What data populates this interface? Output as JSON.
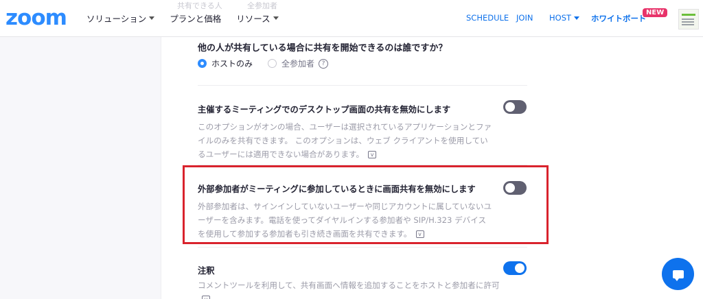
{
  "header": {
    "logo": "zoom",
    "nav_left": [
      {
        "label": "ソリューション",
        "caret": true
      },
      {
        "label": "プランと価格",
        "caret": false
      },
      {
        "label": "リソース",
        "caret": true
      }
    ],
    "schedule": "SCHEDULE",
    "join": "JOIN",
    "host": "HOST",
    "whiteboard": "ホワイトボード",
    "new_badge": "NEW",
    "ghost_left": "共有できる人",
    "ghost_right": "全参加者"
  },
  "sharing_question": {
    "title": "他の人が共有している場合に共有を開始できるのは誰ですか？",
    "options": [
      "ホストのみ",
      "全参加者"
    ],
    "selected": "ホストのみ",
    "help_icon": "?"
  },
  "settings": [
    {
      "title": "主催するミーティングでのデスクトップ画面の共有を無効にします",
      "desc": "このオプションがオンの場合、ユーザーは選択されているアプリケーションとファイルのみを共有できます。 このオプションは、ウェブ クライアントを使用しているユーザーには適用できない場合があります。",
      "toggle": "off"
    },
    {
      "title": "外部参加者がミーティングに参加しているときに画面共有を無効にします",
      "desc": "外部参加者は、サインインしていないユーザーや同じアカウントに属していないユーザーを含みます。電話を使ってダイヤルインする参加者や SIP/H.323 デバイスを使用して参加する参加者も引き続き画面を共有できます。",
      "toggle": "off",
      "highlighted": true
    },
    {
      "title": "注釈",
      "desc": "コメントツールを利用して、共有画面へ情報を追加することをホストと参加者に許可",
      "toggle": "on"
    }
  ],
  "colors": {
    "brand": "#2d8cff",
    "toggle_on": "#0e72ed",
    "toggle_off": "#606071",
    "highlight": "#d9232d",
    "badge": "#e8336a"
  },
  "icons": {
    "chat": "chat-bubble-icon",
    "info": "info-box-icon",
    "help": "question-circle-icon"
  }
}
